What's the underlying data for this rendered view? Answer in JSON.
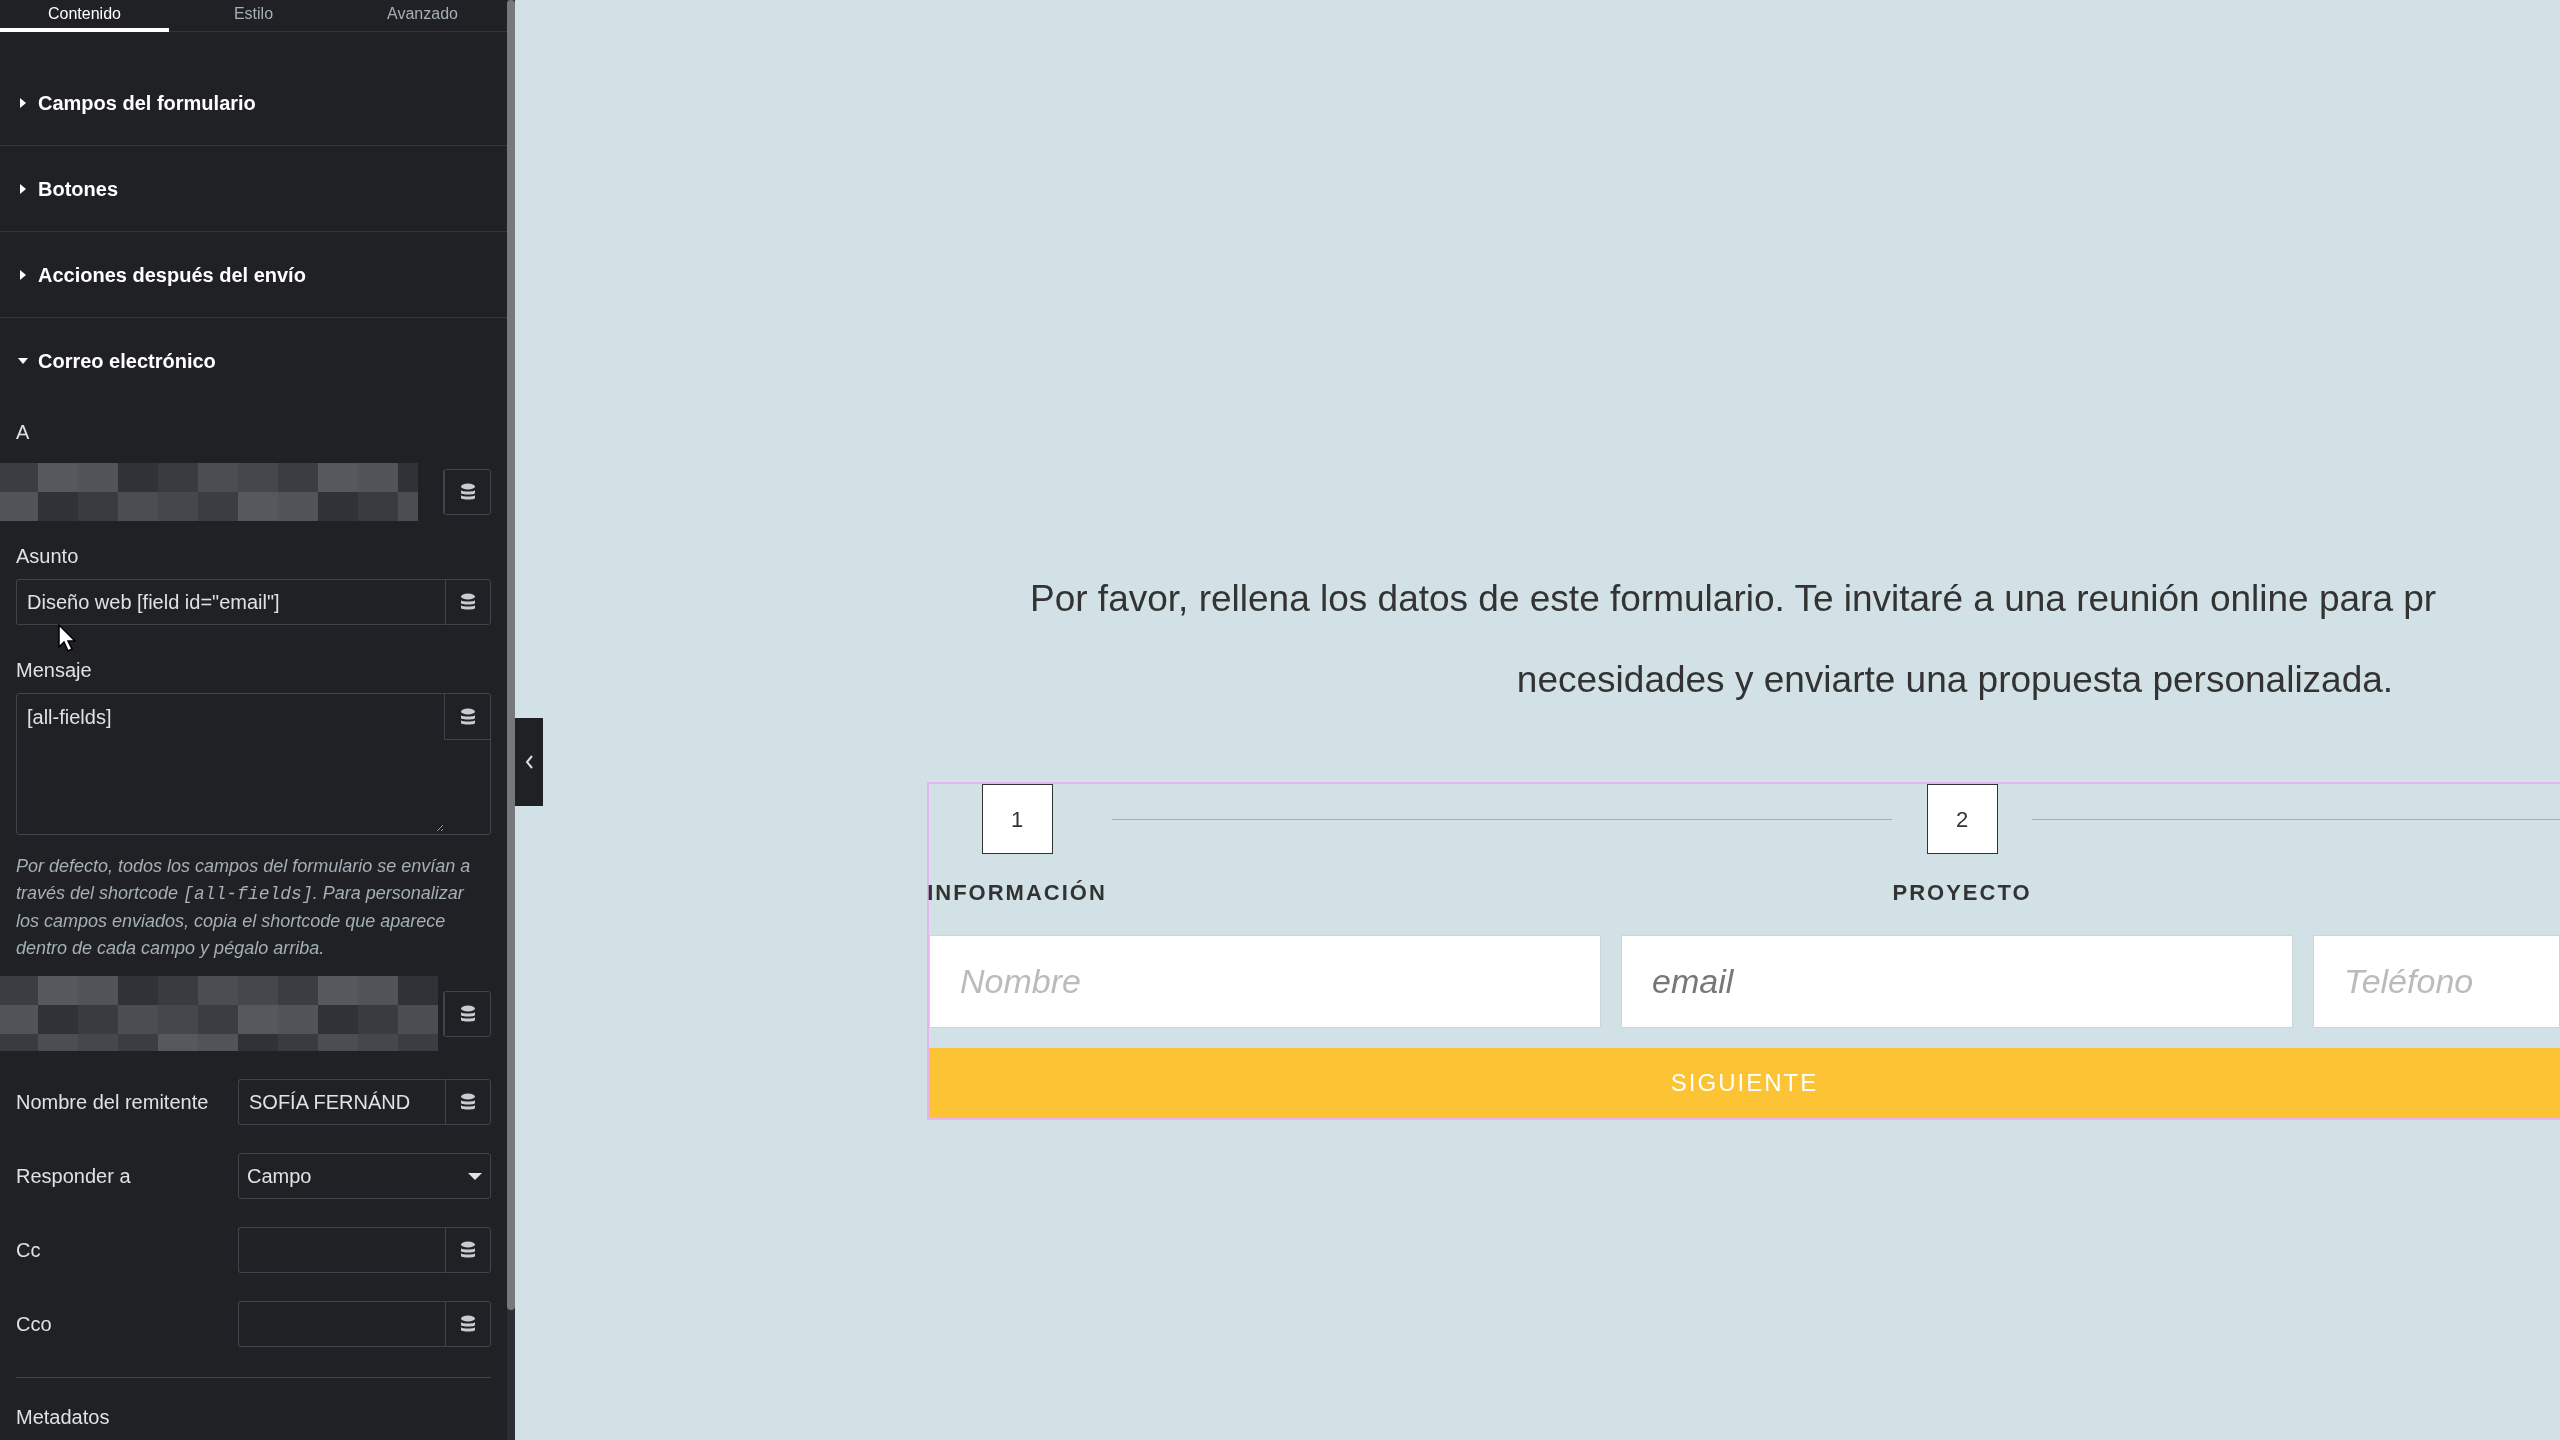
{
  "tabs": [
    {
      "label": "Contenido",
      "selected": true
    },
    {
      "label": "Estilo",
      "selected": false
    },
    {
      "label": "Avanzado",
      "selected": false
    }
  ],
  "sections": [
    {
      "title": "Campos del formulario",
      "expanded": false
    },
    {
      "title": "Botones",
      "expanded": false
    },
    {
      "title": "Acciones después del envío",
      "expanded": false
    },
    {
      "title": "Correo electrónico",
      "expanded": true,
      "fields": [
        {
          "kind": "redacted",
          "label": "A"
        },
        {
          "kind": "stacked",
          "label": "Asunto",
          "value": "Diseño web [field id=\"email\"]"
        },
        {
          "kind": "textarea",
          "label": "Mensaje",
          "value": "[all-fields]",
          "help": [
            {
              "kind": "text",
              "text": "Por defecto, todos los campos del formulario se envían a través del shortcode "
            },
            {
              "kind": "code",
              "text": "[all-fields]"
            },
            {
              "kind": "text",
              "text": ". Para personalizar los campos enviados, copia el shortcode que aparece dentro de cada campo y pégalo arriba."
            }
          ]
        },
        {
          "kind": "redacted_row"
        },
        {
          "kind": "inline",
          "label": "Nombre del remitente",
          "value": "SOFÍA FERNÁND"
        },
        {
          "kind": "select",
          "label": "Responder a",
          "value": "Campo"
        },
        {
          "kind": "inline",
          "label": "Cc"
        },
        {
          "kind": "inline",
          "label": "Cco"
        },
        {
          "kind": "heading",
          "label": "Metadatos"
        }
      ]
    }
  ],
  "canvas": {
    "intro_lines": [
      "Por favor, rellena los datos de este formulario. Te invitaré a una reunión online para pr",
      "necesidades y enviarte una propuesta personalizada."
    ],
    "steps": [
      {
        "number": "1",
        "label": "INFORMACIÓN"
      },
      {
        "number": "2",
        "label": "PROYECTO"
      }
    ],
    "inputs": [
      {
        "placeholder": "Nombre"
      },
      {
        "placeholder": "email"
      },
      {
        "placeholder": "Teléfono"
      }
    ],
    "button": "SIGUIENTE"
  }
}
